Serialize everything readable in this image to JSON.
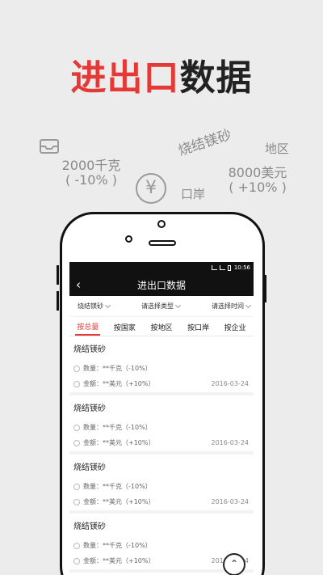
{
  "headline": {
    "part1": "进出口",
    "part2": "数据"
  },
  "floating": {
    "amount_qty": "2000千克\n( -10% )",
    "yen": "¥",
    "port": "口岸",
    "sinter": "烧结镁砂",
    "region": "地区",
    "amount_usd": "8000美元\n( +10% )"
  },
  "statusbar": {
    "time": "10:56"
  },
  "titlebar": {
    "title": "进出口数据"
  },
  "filters": [
    {
      "label": "烧结镁砂"
    },
    {
      "label": "请选择类型"
    },
    {
      "label": "请选择时间"
    }
  ],
  "tabs": [
    {
      "label": "按总量",
      "active": true
    },
    {
      "label": "按国家"
    },
    {
      "label": "按地区"
    },
    {
      "label": "按口岸"
    },
    {
      "label": "按企业"
    }
  ],
  "cards": [
    {
      "title": "烧结镁砂",
      "qty": "数量：**千克（-10%）",
      "amount": "金额：**美元（+10%）",
      "date": "2016-03-24"
    },
    {
      "title": "烧结镁砂",
      "qty": "数量：**千克（-10%）",
      "amount": "金额：**美元（+10%）",
      "date": "2016-03-24"
    },
    {
      "title": "烧结镁砂",
      "qty": "数量：**千克（-10%）",
      "amount": "金额：**美元（+10%）",
      "date": "2016-03-24"
    },
    {
      "title": "烧结镁砂",
      "qty": "数量：**千克（-10%）",
      "amount": "金额：**美元（+10%）",
      "date": "2016-03-24"
    }
  ],
  "colors": {
    "accent": "#e53935",
    "bar": "#111111"
  }
}
